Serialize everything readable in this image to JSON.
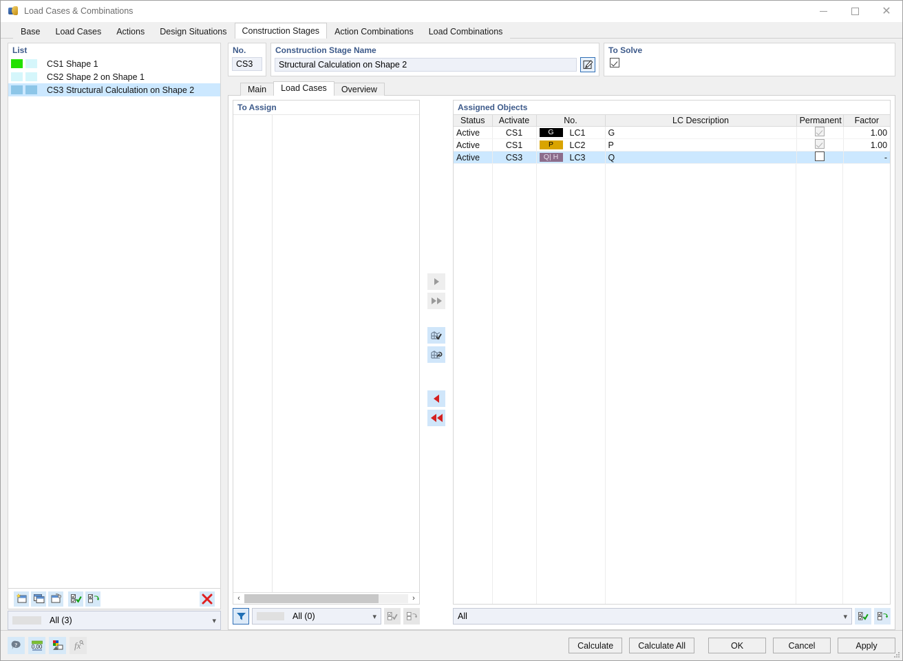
{
  "window": {
    "title": "Load Cases & Combinations",
    "icon": "app-icon",
    "minimize": "–",
    "maximize": "□",
    "close": "✕"
  },
  "main_tabs": [
    {
      "label": "Base",
      "active": false
    },
    {
      "label": "Load Cases",
      "active": false
    },
    {
      "label": "Actions",
      "active": false
    },
    {
      "label": "Design Situations",
      "active": false
    },
    {
      "label": "Construction Stages",
      "active": true
    },
    {
      "label": "Action Combinations",
      "active": false
    },
    {
      "label": "Load Combinations",
      "active": false
    }
  ],
  "list_panel": {
    "title": "List",
    "rows": [
      {
        "no": "CS1",
        "name": "Shape 1",
        "color1": "#22e000",
        "color2": "#d5f6fb",
        "selected": false
      },
      {
        "no": "CS2",
        "name": "Shape 2 on Shape 1",
        "color1": "#d5f6fb",
        "color2": "#d5f6fb",
        "selected": false
      },
      {
        "no": "CS3",
        "name": "Structural Calculation on Shape 2",
        "color1": "#8dc6e8",
        "color2": "#8dc6e8",
        "selected": true
      }
    ],
    "toolbar": [
      {
        "name": "new-construction-stage-button",
        "icon": "new-window-icon"
      },
      {
        "name": "copy-construction-stage-button",
        "icon": "copy-window-icon"
      },
      {
        "name": "import-construction-stage-button",
        "icon": "import-window-icon"
      },
      {
        "name": "select-all-button",
        "icon": "checkbox-check-icon"
      },
      {
        "name": "invert-selection-button",
        "icon": "checkbox-swap-icon"
      },
      {
        "name": "delete-button",
        "icon": "red-x-icon"
      }
    ],
    "filter_select": {
      "value": "All (3)",
      "caret": "⌄"
    }
  },
  "number_panel": {
    "title": "No.",
    "value": "CS3"
  },
  "name_panel": {
    "title": "Construction Stage Name",
    "value": "Structural Calculation on Shape 2",
    "edit_icon": "edit-pencil-icon"
  },
  "solve_panel": {
    "title": "To Solve",
    "checked": true
  },
  "inner_tabs": [
    {
      "label": "Main",
      "active": false
    },
    {
      "label": "Load Cases",
      "active": true
    },
    {
      "label": "Overview",
      "active": false
    }
  ],
  "to_assign": {
    "title": "To Assign",
    "rows": [],
    "scroll_left": "‹",
    "scroll_right": "›",
    "filter_icon": "funnel-icon",
    "filter_select": {
      "value": "All (0)",
      "caret": "⌄"
    },
    "buttons": [
      {
        "name": "select-all-to-assign-button",
        "icon": "checkbox-check-icon"
      },
      {
        "name": "invert-to-assign-button",
        "icon": "checkbox-swap-icon"
      }
    ]
  },
  "transfer_buttons": [
    {
      "name": "assign-selected-button",
      "icon": "arrow-right-icon",
      "state": "disabled"
    },
    {
      "name": "assign-all-button",
      "icon": "double-arrow-right-icon",
      "state": "disabled"
    },
    {
      "name": "new-load-case-button",
      "icon": "grid-check-icon",
      "state": "enabled"
    },
    {
      "name": "edit-load-case-button",
      "icon": "grid-wrench-icon",
      "state": "enabled"
    },
    {
      "name": "unassign-selected-button",
      "icon": "arrow-left-icon",
      "state": "enabled"
    },
    {
      "name": "unassign-all-button",
      "icon": "double-arrow-left-icon",
      "state": "enabled"
    }
  ],
  "assigned": {
    "title": "Assigned Objects",
    "columns": [
      "Status",
      "Activate",
      "No.",
      "LC Description",
      "Permanent",
      "Factor"
    ],
    "rows": [
      {
        "status": "Active",
        "activate": "CS1",
        "badge": "G",
        "badge_style": "g",
        "no": "LC1",
        "description": "G",
        "permanent": "checked-dim",
        "factor": "1.00",
        "selected": false
      },
      {
        "status": "Active",
        "activate": "CS1",
        "badge": "P",
        "badge_style": "p",
        "no": "LC2",
        "description": "P",
        "permanent": "checked-dim",
        "factor": "1.00",
        "selected": false
      },
      {
        "status": "Active",
        "activate": "CS3",
        "badge": "Q| H",
        "badge_style": "q",
        "no": "LC3",
        "description": "Q",
        "permanent": "unchecked",
        "factor": "-",
        "selected": true
      }
    ],
    "filter_select": {
      "value": "All",
      "caret": "⌄"
    },
    "buttons": [
      {
        "name": "select-all-assigned-button",
        "icon": "checkbox-check-icon"
      },
      {
        "name": "invert-assigned-button",
        "icon": "checkbox-swap-icon"
      }
    ]
  },
  "statusbar": {
    "left_buttons": [
      {
        "name": "info-button",
        "icon": "info-bubble-icon",
        "enabled": true
      },
      {
        "name": "decimal-places-button",
        "icon": "number-format-icon",
        "enabled": true
      },
      {
        "name": "display-properties-button",
        "icon": "color-palette-icon",
        "enabled": true
      },
      {
        "name": "formula-button",
        "icon": "fx-icon",
        "enabled": false
      }
    ],
    "right_buttons": [
      {
        "name": "calculate-button",
        "label": "Calculate"
      },
      {
        "name": "calculate-all-button",
        "label": "Calculate All"
      },
      {
        "name": "ok-button",
        "label": "OK"
      },
      {
        "name": "cancel-button",
        "label": "Cancel"
      },
      {
        "name": "apply-button",
        "label": "Apply"
      }
    ]
  },
  "colors": {
    "accent": "#3d5a8a",
    "selection": "#cce8ff",
    "badge_g_bg": "#000000",
    "badge_p_bg": "#d9a400",
    "badge_q_bg": "#8c6d8c",
    "delete_red": "#d42020"
  }
}
